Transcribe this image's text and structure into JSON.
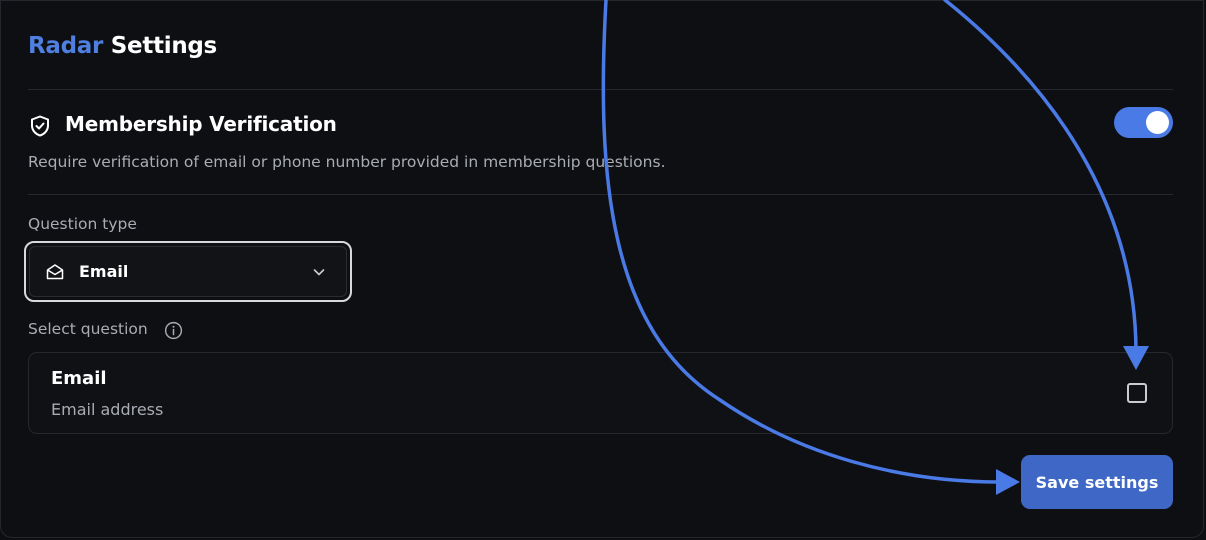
{
  "header": {
    "brand": "Radar",
    "title": "Settings"
  },
  "membership_verification": {
    "title": "Membership Verification",
    "description": "Require verification of email or phone number provided in membership questions.",
    "toggle_on": true,
    "icon": "shield-check-icon"
  },
  "question_type": {
    "label": "Question type",
    "selected": "Email",
    "icon": "envelope-open-icon"
  },
  "select_question": {
    "label": "Select question",
    "info_icon": "info-icon",
    "options": [
      {
        "title": "Email",
        "subtitle": "Email address",
        "checked": false
      }
    ]
  },
  "actions": {
    "save_label": "Save settings"
  },
  "colors": {
    "accent": "#4a7ae6",
    "button": "#3f68c6",
    "annotation_arrow": "#4a7ae6",
    "background": "#0e0f13"
  }
}
